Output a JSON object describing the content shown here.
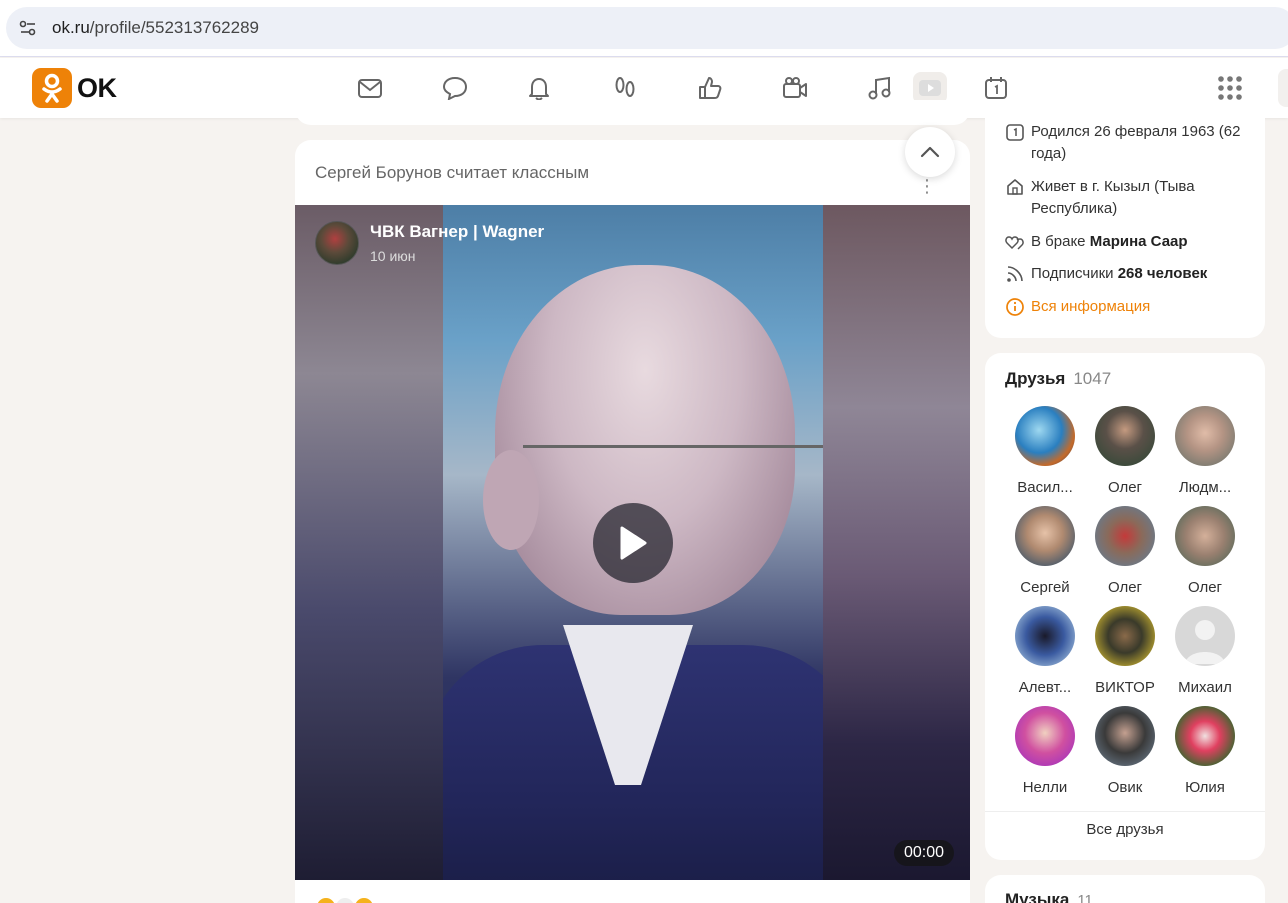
{
  "browser": {
    "url_host": "ok.ru",
    "url_path": "/profile/552313762289"
  },
  "nav": {
    "logo_text": "OK",
    "icons": [
      "mail-icon",
      "chat-icon",
      "bell-icon",
      "footprints-icon",
      "like-icon",
      "video-camera-icon",
      "music-icon",
      "video-play-icon",
      "calendar-icon",
      "apps-grid-icon"
    ]
  },
  "post": {
    "header": "Сергей Борунов считает классным",
    "author": "ЧВК Вагнер | Wagner",
    "date": "10 июн",
    "duration": "00:00"
  },
  "info": {
    "born": "Родился 26 февраля 1963 (62 года)",
    "lives": "Живет в г. Кызыл (Тыва Республика)",
    "married_prefix": "В браке",
    "married_name": "Марина Саар",
    "subs_prefix": "Подписчики",
    "subs_count": "268 человек",
    "all_info": "Вся информация"
  },
  "friends": {
    "title": "Друзья",
    "count": "1047",
    "items": [
      {
        "name": "Васил..."
      },
      {
        "name": "Олег"
      },
      {
        "name": "Людм..."
      },
      {
        "name": "Сергей"
      },
      {
        "name": "Олег"
      },
      {
        "name": "Олег"
      },
      {
        "name": "Алевт..."
      },
      {
        "name": "ВИКТОР"
      },
      {
        "name": "Михаил"
      },
      {
        "name": "Нелли"
      },
      {
        "name": "Овик"
      },
      {
        "name": "Юлия"
      }
    ],
    "all_label": "Все друзья"
  },
  "music": {
    "title": "Музыка",
    "count": "11"
  },
  "colors": {
    "brand": "#ee8208",
    "background": "#f6f3f0"
  }
}
